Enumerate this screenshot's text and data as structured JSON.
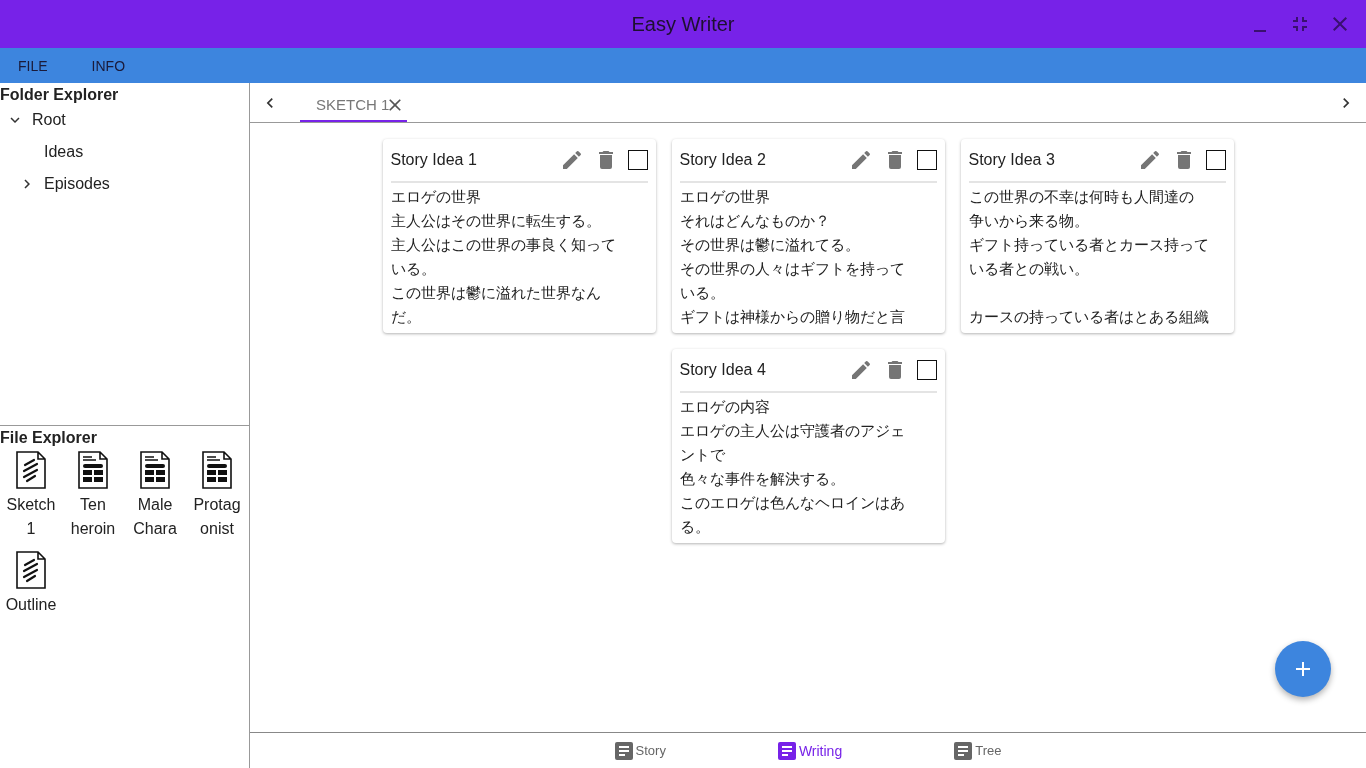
{
  "window": {
    "title": "Easy Writer"
  },
  "menu": [
    "FILE",
    "INFO"
  ],
  "folder_explorer": {
    "title": "Folder Explorer",
    "tree": [
      {
        "label": "Root",
        "expanded": true,
        "children": [
          {
            "label": "Ideas"
          },
          {
            "label": "Episodes",
            "expanded": false
          }
        ]
      }
    ]
  },
  "file_explorer": {
    "title": "File Explorer",
    "files": [
      {
        "name": "Sketch 1",
        "kind": "sketch"
      },
      {
        "name": "Ten heroin",
        "kind": "table"
      },
      {
        "name": "Male Chara",
        "kind": "table"
      },
      {
        "name": "Protagonist",
        "kind": "table"
      },
      {
        "name": "Outline",
        "kind": "sketch"
      }
    ]
  },
  "tabs": [
    {
      "label": "SKETCH 1",
      "selected": true
    }
  ],
  "cards": [
    {
      "title": "Story Idea 1",
      "checked": false,
      "paragraphs": [
        [
          "エロゲの世界",
          "主人公はその世界に転生する。",
          "主人公はこの世界の事良く知って",
          "いる。",
          "この世界は鬱に溢れた世界なん",
          "だ。"
        ]
      ]
    },
    {
      "title": "Story Idea 2",
      "checked": false,
      "paragraphs": [
        [
          "エロゲの世界",
          "それはどんなものか？",
          "その世界は鬱に溢れてる。",
          "その世界の人々はギフトを持って",
          "いる。",
          "ギフトは神様からの贈り物だと言"
        ]
      ]
    },
    {
      "title": "Story Idea 3",
      "checked": false,
      "paragraphs": [
        [
          "この世界の不幸は何時も人間達の",
          "争いから来る物。",
          "ギフト持っている者とカース持って",
          "いる者との戦い。"
        ],
        [
          "カースの持っている者はとある組織"
        ]
      ]
    },
    {
      "title": "Story Idea 4",
      "checked": false,
      "paragraphs": [
        [
          "エロゲの内容",
          "エロゲの主人公は守護者のアジェ",
          "ントで",
          "色々な事件を解決する。",
          "このエロゲは色んなヘロインはあ",
          "る。"
        ]
      ]
    }
  ],
  "bottom_nav": [
    {
      "label": "Story",
      "selected": false
    },
    {
      "label": "Writing",
      "selected": true
    },
    {
      "label": "Tree",
      "selected": false
    }
  ]
}
